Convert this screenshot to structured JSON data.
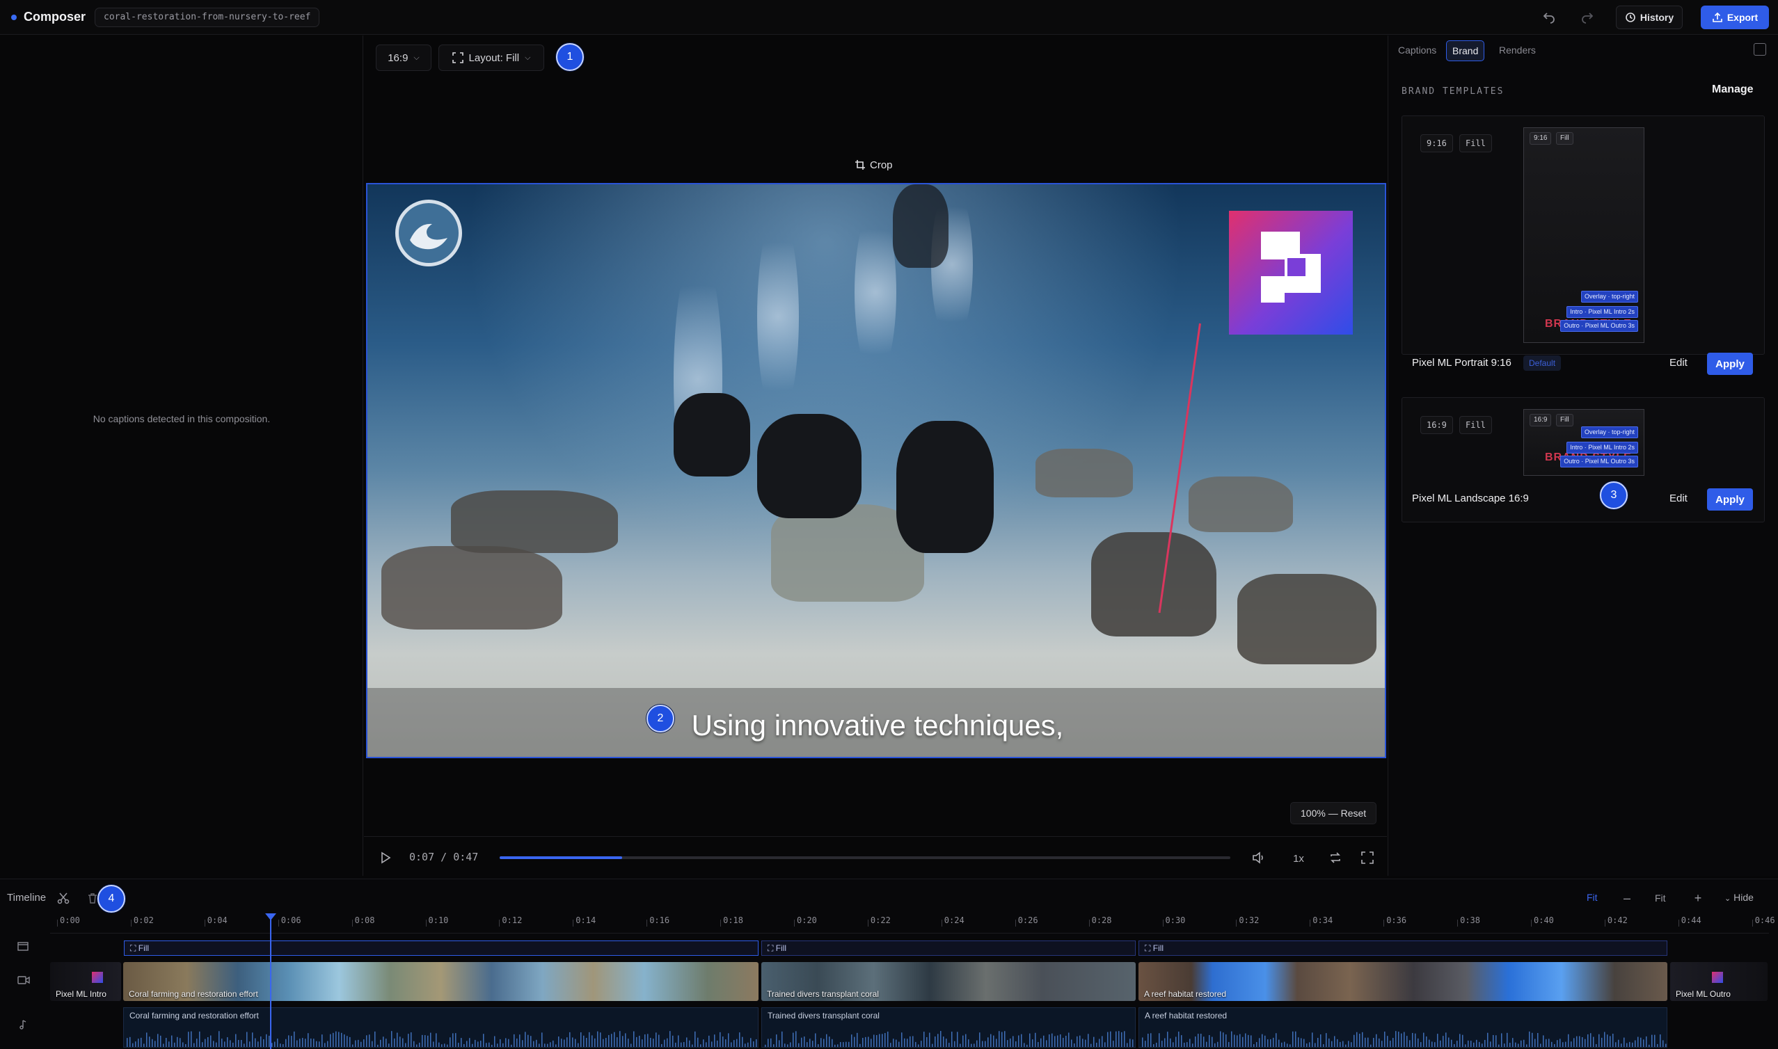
{
  "app": {
    "name": "Composer",
    "project": "coral-restoration-from-nursery-to-reef"
  },
  "toolbar": {
    "history_label": "History",
    "export_label": "Export"
  },
  "left_panel": {
    "empty_message": "No captions detected in this composition."
  },
  "preview": {
    "aspect_ratio": "16:9",
    "layout_label": "Layout: Fill",
    "crop_label": "Crop",
    "caption_text": "Using innovative techniques,",
    "zoom_reset_label": "100% — Reset"
  },
  "player": {
    "current_time": "0:07",
    "separator": "/",
    "duration": "0:47",
    "progress_fraction": 0.168,
    "speed_label": "1x"
  },
  "right_panel": {
    "tabs": [
      {
        "label": "Captions",
        "active": false
      },
      {
        "label": "Brand",
        "active": true
      },
      {
        "label": "Renders",
        "active": false
      }
    ],
    "section_title": "BRAND TEMPLATES",
    "manage_label": "Manage",
    "templates": [
      {
        "name": "Pixel ML Portrait 9:16",
        "ratio": "9:16",
        "layout": "Fill",
        "default_tag": "Default",
        "overlays": [
          "Overlay · top-right",
          "Intro · Pixel ML Intro 2s",
          "Outro · Pixel ML Outro 3s"
        ],
        "edit_label": "Edit",
        "apply_label": "Apply"
      },
      {
        "name": "Pixel ML Landscape 16:9",
        "ratio": "16:9",
        "layout": "Fill",
        "overlays": [
          "Overlay · top-right",
          "Intro · Pixel ML Intro 2s",
          "Outro · Pixel ML Outro 3s"
        ],
        "edit_label": "Edit",
        "apply_label": "Apply"
      }
    ],
    "thumb_brand_text": "BRAND STYLE"
  },
  "badges": [
    "1",
    "2",
    "3",
    "4"
  ],
  "timeline": {
    "label": "Timeline",
    "fit_active_label": "Fit",
    "fit_label": "Fit",
    "hide_label": "Hide",
    "ruler": [
      "0:00",
      "0:02",
      "0:04",
      "0:06",
      "0:08",
      "0:10",
      "0:12",
      "0:14",
      "0:16",
      "0:18",
      "0:20",
      "0:22",
      "0:24",
      "0:26",
      "0:28",
      "0:30",
      "0:32",
      "0:34",
      "0:36",
      "0:38",
      "0:40",
      "0:42",
      "0:44",
      "0:46"
    ],
    "layout_segments": [
      "Fill",
      "Fill",
      "Fill"
    ],
    "clips": [
      {
        "label": "Pixel ML Intro"
      },
      {
        "label": "Coral farming and restoration effort"
      },
      {
        "label": "Trained divers transplant coral"
      },
      {
        "label": "A reef habitat restored"
      },
      {
        "label": "Pixel ML Outro"
      }
    ],
    "audio_segments": [
      "Coral farming and restoration effort",
      "Trained divers transplant coral",
      "A reef habitat restored"
    ]
  },
  "colors": {
    "accent": "#2f5ce8",
    "background": "#070708",
    "panel_border": "#1b1b1f"
  },
  "icons": {
    "undo": "undo-icon",
    "redo": "redo-icon",
    "history": "history-icon",
    "export": "upload-icon",
    "crop": "crop-icon",
    "play": "play-icon",
    "mute": "volume-icon",
    "loop": "loop-icon",
    "fullscreen": "fullscreen-icon",
    "cut": "scissors-icon",
    "delete": "trash-icon"
  }
}
